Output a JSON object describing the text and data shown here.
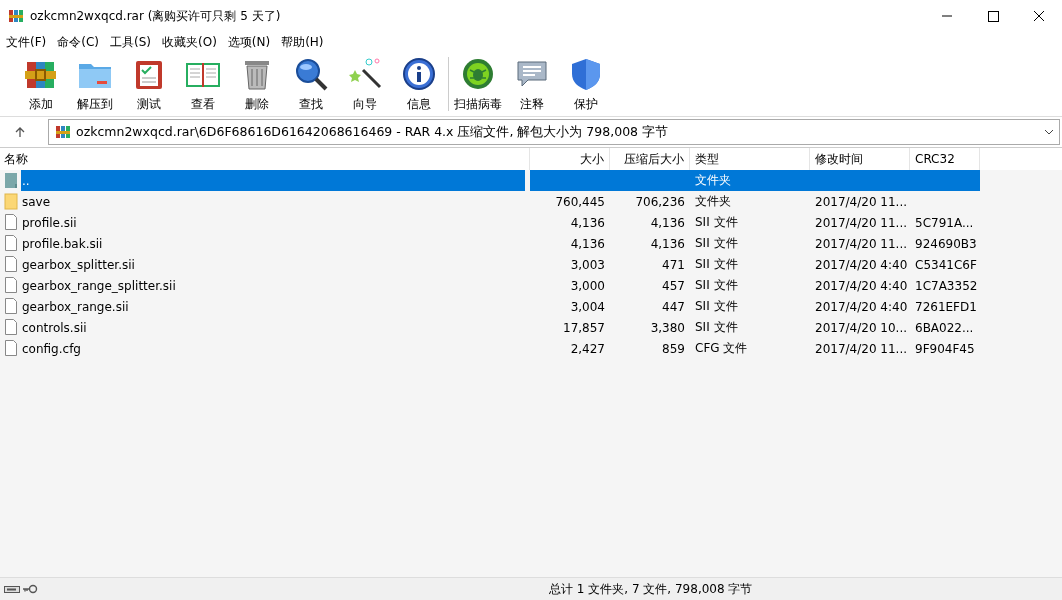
{
  "window": {
    "title": "ozkcmn2wxqcd.rar (离购买许可只剩 5 天了)"
  },
  "menu": [
    "文件(F)",
    "命令(C)",
    "工具(S)",
    "收藏夹(O)",
    "选项(N)",
    "帮助(H)"
  ],
  "toolbar": [
    {
      "label": "添加",
      "kind": "add"
    },
    {
      "label": "解压到",
      "kind": "extract"
    },
    {
      "label": "测试",
      "kind": "test"
    },
    {
      "label": "查看",
      "kind": "view"
    },
    {
      "label": "删除",
      "kind": "delete"
    },
    {
      "label": "查找",
      "kind": "find"
    },
    {
      "label": "向导",
      "kind": "wizard"
    },
    {
      "label": "信息",
      "kind": "info"
    },
    {
      "label": "扫描病毒",
      "kind": "scan"
    },
    {
      "label": "注释",
      "kind": "comment"
    },
    {
      "label": "保护",
      "kind": "protect"
    }
  ],
  "address": {
    "path": "ozkcmn2wxqcd.rar\\6D6F68616D61642068616469 - RAR 4.x 压缩文件, 解包大小为 798,008 字节"
  },
  "table": {
    "columns": [
      "名称",
      "大小",
      "压缩后大小",
      "类型",
      "修改时间",
      "CRC32"
    ],
    "rows": [
      {
        "kind": "up",
        "selected": true,
        "cells": [
          "..",
          "",
          "",
          "文件夹",
          "",
          ""
        ]
      },
      {
        "kind": "folder",
        "selected": false,
        "cells": [
          "save",
          "760,445",
          "706,236",
          "文件夹",
          "2017/4/20 11...",
          ""
        ]
      },
      {
        "kind": "file",
        "selected": false,
        "cells": [
          "profile.sii",
          "4,136",
          "4,136",
          "SII 文件",
          "2017/4/20 11...",
          "5C791A..."
        ]
      },
      {
        "kind": "file",
        "selected": false,
        "cells": [
          "profile.bak.sii",
          "4,136",
          "4,136",
          "SII 文件",
          "2017/4/20 11...",
          "924690B3"
        ]
      },
      {
        "kind": "file",
        "selected": false,
        "cells": [
          "gearbox_splitter.sii",
          "3,003",
          "471",
          "SII 文件",
          "2017/4/20 4:40",
          "C5341C6F"
        ]
      },
      {
        "kind": "file",
        "selected": false,
        "cells": [
          "gearbox_range_splitter.sii",
          "3,000",
          "457",
          "SII 文件",
          "2017/4/20 4:40",
          "1C7A3352"
        ]
      },
      {
        "kind": "file",
        "selected": false,
        "cells": [
          "gearbox_range.sii",
          "3,004",
          "447",
          "SII 文件",
          "2017/4/20 4:40",
          "7261EFD1"
        ]
      },
      {
        "kind": "file",
        "selected": false,
        "cells": [
          "controls.sii",
          "17,857",
          "3,380",
          "SII 文件",
          "2017/4/20 10...",
          "6BA022..."
        ]
      },
      {
        "kind": "file",
        "selected": false,
        "cells": [
          "config.cfg",
          "2,427",
          "859",
          "CFG 文件",
          "2017/4/20 11...",
          "9F904F45"
        ]
      }
    ]
  },
  "status_bar": {
    "text": "总计 1 文件夹, 7 文件, 798,008 字节"
  }
}
